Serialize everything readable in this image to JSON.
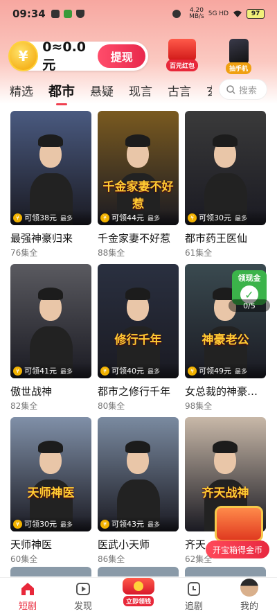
{
  "status_bar": {
    "time": "09:34",
    "net_speed_value": "4.20",
    "net_speed_unit": "MB/s",
    "network": "5G HD",
    "battery": "97"
  },
  "wallet": {
    "coin_symbol": "¥",
    "amount": "0≈0.0元",
    "withdraw_label": "提现"
  },
  "promos": {
    "redpack_label": "百元红包",
    "phone_label": "抽手机"
  },
  "tabs": [
    "精选",
    "都市",
    "悬疑",
    "现言",
    "古言",
    "玄"
  ],
  "active_tab": "都市",
  "search": {
    "placeholder": "搜索"
  },
  "dramas": [
    {
      "title": "最强神豪归来",
      "episodes": "76集全",
      "reward": "可领38元",
      "max": "最多",
      "overlay": "",
      "color": "#4a5a80"
    },
    {
      "title": "千金家妻不好惹",
      "episodes": "88集全",
      "reward": "可领44元",
      "max": "最多",
      "overlay": "千金家妻不好惹",
      "color": "#7a5a20"
    },
    {
      "title": "都市药王医仙",
      "episodes": "61集全",
      "reward": "可领30元",
      "max": "最多",
      "overlay": "",
      "color": "#3a3a3a"
    },
    {
      "title": "傲世战神",
      "episodes": "82集全",
      "reward": "可领41元",
      "max": "最多",
      "overlay": "",
      "color": "#5a5a60"
    },
    {
      "title": "都市之修行千年",
      "episodes": "80集全",
      "reward": "可领40元",
      "max": "最多",
      "overlay": "修行千年",
      "color": "#2a3040"
    },
    {
      "title": "女总裁的神豪…",
      "episodes": "98集全",
      "reward": "可领49元",
      "max": "最多",
      "overlay": "神豪老公",
      "color": "#3a4a50"
    },
    {
      "title": "天师神医",
      "episodes": "60集全",
      "reward": "可领30元",
      "max": "最多",
      "overlay": "天师神医",
      "color": "#8090a8"
    },
    {
      "title": "医武小天师",
      "episodes": "86集全",
      "reward": "可领43元",
      "max": "最多",
      "overlay": "",
      "color": "#7a8aa0"
    },
    {
      "title": "齐天",
      "episodes": "62集全",
      "reward": "",
      "max": "",
      "overlay": "齐天战神",
      "color": "#c8b8a8"
    }
  ],
  "cashout_widget": {
    "title": "领现金",
    "progress": "0/5"
  },
  "treasure": {
    "label": "开宝箱得金币"
  },
  "bottom_nav": {
    "items": [
      "短剧",
      "发现",
      "立即领钱",
      "追剧",
      "我的"
    ],
    "active": "短剧"
  },
  "colors": {
    "accent": "#e8283a",
    "tab_indicator": "#f04050"
  }
}
